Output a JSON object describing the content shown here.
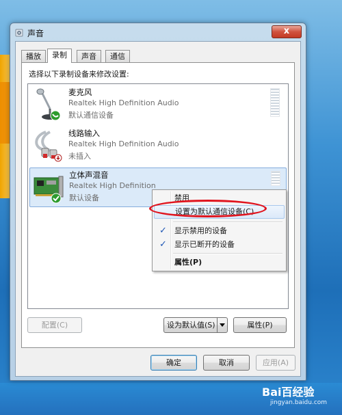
{
  "window": {
    "title": "声音",
    "close_label": "x"
  },
  "tabs": [
    {
      "label": "播放"
    },
    {
      "label": "录制"
    },
    {
      "label": "声音"
    },
    {
      "label": "通信"
    }
  ],
  "instruction": "选择以下录制设备来修改设置:",
  "devices": [
    {
      "name": "麦克风",
      "driver": "Realtek High Definition Audio",
      "state": "默认通信设备",
      "icon": "microphone-icon",
      "badge": "phone-badge-icon"
    },
    {
      "name": "线路输入",
      "driver": "Realtek High Definition Audio",
      "state": "未插入",
      "icon": "line-in-cable-icon",
      "badge": "unplugged-badge-icon"
    },
    {
      "name": "立体声混音",
      "driver": "Realtek High Definition",
      "state": "默认设备",
      "icon": "sound-card-icon",
      "badge": "check-badge-icon"
    }
  ],
  "context_menu": {
    "items": [
      {
        "label": "禁用",
        "checked": false
      },
      {
        "label": "设置为默认通信设备(C)",
        "checked": false,
        "highlighted": true
      },
      {
        "label": "显示禁用的设备",
        "checked": true
      },
      {
        "label": "显示已断开的设备",
        "checked": true
      },
      {
        "label": "属性(P)",
        "checked": false,
        "bold": true
      }
    ],
    "check_glyph": "✓"
  },
  "buttons": {
    "configure": "配置(C)",
    "set_default": "设为默认值(S)",
    "properties": "属性(P)",
    "ok": "确定",
    "cancel": "取消",
    "apply": "应用(A)"
  },
  "watermark": {
    "brand": "Bai百经验",
    "site": "jingyan.baidu.com"
  },
  "colors": {
    "highlight_oval": "#e0141e",
    "selection": "#dbeaf9",
    "check": "#1d56b5"
  }
}
